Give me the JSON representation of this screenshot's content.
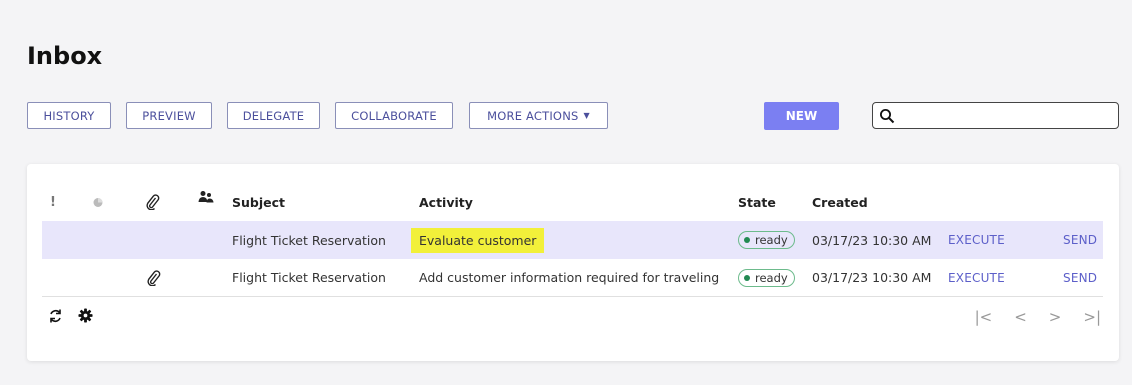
{
  "page": {
    "title": "Inbox"
  },
  "toolbar": {
    "history": "HISTORY",
    "preview": "PREVIEW",
    "delegate": "DELEGATE",
    "collaborate": "COLLABORATE",
    "more_actions": "MORE ACTIONS",
    "new": "NEW"
  },
  "search": {
    "value": "",
    "placeholder": ""
  },
  "table": {
    "columns": {
      "priority": "!",
      "subject": "Subject",
      "activity": "Activity",
      "state": "State",
      "created": "Created"
    },
    "rows": [
      {
        "subject": "Flight Ticket Reservation",
        "activity": "Evaluate customer",
        "state": "ready",
        "created": "03/17/23 10:30 AM",
        "execute": "EXECUTE",
        "send": "SEND",
        "has_attachment": false,
        "selected": true
      },
      {
        "subject": "Flight Ticket Reservation",
        "activity": "Add customer information required for traveling",
        "state": "ready",
        "created": "03/17/23 10:30 AM",
        "execute": "EXECUTE",
        "send": "SEND",
        "has_attachment": true,
        "selected": false
      }
    ]
  },
  "pager": {
    "first": "|<",
    "prev": "<",
    "next": ">",
    "last": ">|"
  },
  "colors": {
    "accent": "#7b7ff2",
    "link": "#5c5fc9",
    "selected_row": "#e8e6fb",
    "highlight": "#f2f03a",
    "state_dot": "#228a52"
  },
  "icons": {
    "priority": "exclamation-icon",
    "read_status": "circle-status-icon",
    "attachment": "paperclip-icon",
    "assignees": "people-icon",
    "search": "search-icon",
    "refresh": "refresh-icon",
    "settings": "gear-icon"
  }
}
